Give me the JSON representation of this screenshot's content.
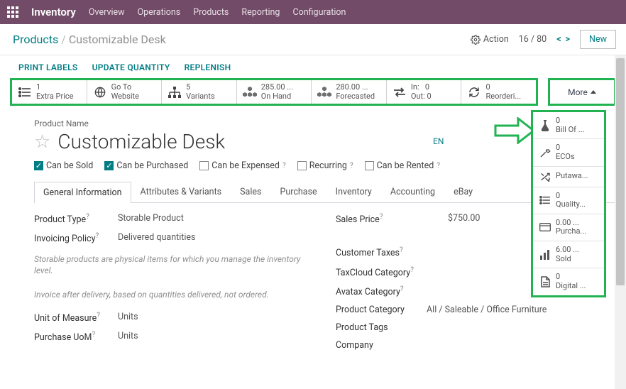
{
  "topnav": {
    "brand": "Inventory",
    "items": [
      "Overview",
      "Operations",
      "Products",
      "Reporting",
      "Configuration"
    ]
  },
  "subhead": {
    "crumb1": "Products",
    "crumb2": "Customizable Desk",
    "action": "Action",
    "pager": "16 / 80",
    "new": "New"
  },
  "toolbar": [
    "Print Labels",
    "Update Quantity",
    "Replenish"
  ],
  "stats": {
    "extra_price": {
      "value": "1",
      "label": "Extra Price"
    },
    "website": {
      "top": "Go To",
      "label": "Website"
    },
    "variants": {
      "value": "5",
      "label": "Variants"
    },
    "onhand": {
      "value": "285.00 ...",
      "label": "On Hand"
    },
    "forecast": {
      "value": "280.00 ...",
      "label": "Forecasted"
    },
    "inout": {
      "in_label": "In:",
      "in_val": "0",
      "out_label": "Out:",
      "out_val": "0"
    },
    "reorder": {
      "value": "0",
      "label": "Reorderi..."
    },
    "more": "More"
  },
  "product": {
    "name_label": "Product Name",
    "name": "Customizable Desk",
    "lang": "EN"
  },
  "flags": {
    "sold": "Can be Sold",
    "purchased": "Can be Purchased",
    "expensed": "Can be Expensed",
    "recurring": "Recurring",
    "rented": "Can be Rented"
  },
  "tabs": [
    "General Information",
    "Attributes & Variants",
    "Sales",
    "Purchase",
    "Inventory",
    "Accounting",
    "eBay"
  ],
  "left_col": {
    "product_type_label": "Product Type",
    "product_type_value": "Storable Product",
    "invoicing_label": "Invoicing Policy",
    "invoicing_value": "Delivered quantities",
    "hint1": "Storable products are physical items for which you manage the inventory level.",
    "hint2": "Invoice after delivery, based on quantities delivered, not ordered.",
    "uom_label": "Unit of Measure",
    "uom_value": "Units",
    "puom_label": "Purchase UoM",
    "puom_value": "Units"
  },
  "right_col": {
    "price_label": "Sales Price",
    "price_value": "$750.00",
    "cust_tax": "Customer Taxes",
    "taxcloud": "TaxCloud Category",
    "avatax": "Avatax Category",
    "pcat_label": "Product Category",
    "pcat_value": "All / Saleable / Office Furniture",
    "ptags": "Product Tags",
    "company": "Company"
  },
  "side": {
    "bom": {
      "value": "0",
      "label": "Bill Of ..."
    },
    "ecos": {
      "value": "0",
      "label": "ECOs"
    },
    "putaway": {
      "value": "",
      "label": "Putawa..."
    },
    "quality": {
      "value": "0",
      "label": "Quality..."
    },
    "purcha": {
      "value": "0.00 ...",
      "label": "Purcha..."
    },
    "sold": {
      "value": "6.00 ...",
      "label": "Sold"
    },
    "digital": {
      "value": "0",
      "label": "Digital ..."
    }
  }
}
